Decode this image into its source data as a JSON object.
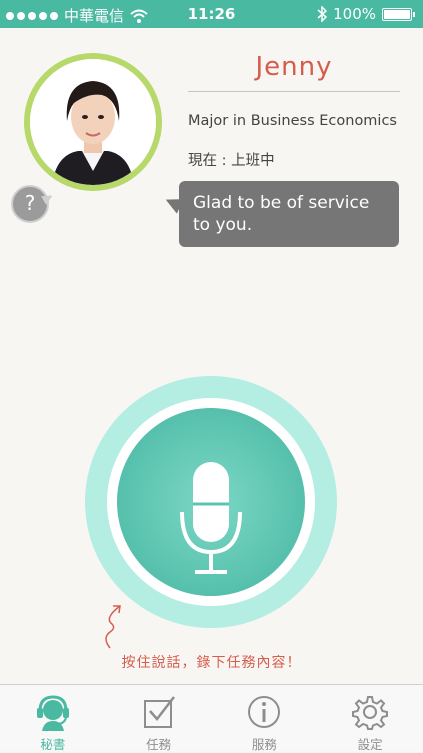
{
  "status_bar": {
    "carrier": "中華電信",
    "time": "11:26",
    "battery": "100%"
  },
  "profile": {
    "name": "Jenny",
    "major": "Major in Business Economics",
    "status": "現在 : 上班中",
    "help_symbol": "?"
  },
  "speech_bubble": {
    "text": "Glad to be of service to you."
  },
  "hint": "按住說話，錄下任務內容！",
  "tabs": [
    {
      "label": "秘書",
      "icon": "headset-icon",
      "active": true
    },
    {
      "label": "任務",
      "icon": "checkbox-icon",
      "active": false
    },
    {
      "label": "服務",
      "icon": "info-icon",
      "active": false
    },
    {
      "label": "設定",
      "icon": "gear-icon",
      "active": false
    }
  ],
  "colors": {
    "accent": "#4ab9a1",
    "name": "#d65d4c",
    "mic_ring": "#b4ede2",
    "bubble": "#767676",
    "avatar_ring": "#b6d96a"
  }
}
